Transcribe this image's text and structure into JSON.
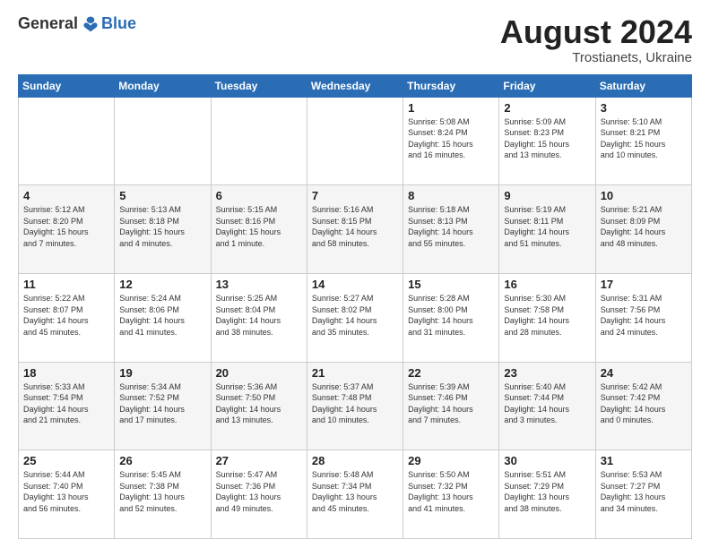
{
  "header": {
    "logo_general": "General",
    "logo_blue": "Blue",
    "month_title": "August 2024",
    "location": "Trostianets, Ukraine"
  },
  "days_of_week": [
    "Sunday",
    "Monday",
    "Tuesday",
    "Wednesday",
    "Thursday",
    "Friday",
    "Saturday"
  ],
  "weeks": [
    [
      {
        "day": "",
        "info": ""
      },
      {
        "day": "",
        "info": ""
      },
      {
        "day": "",
        "info": ""
      },
      {
        "day": "",
        "info": ""
      },
      {
        "day": "1",
        "info": "Sunrise: 5:08 AM\nSunset: 8:24 PM\nDaylight: 15 hours\nand 16 minutes."
      },
      {
        "day": "2",
        "info": "Sunrise: 5:09 AM\nSunset: 8:23 PM\nDaylight: 15 hours\nand 13 minutes."
      },
      {
        "day": "3",
        "info": "Sunrise: 5:10 AM\nSunset: 8:21 PM\nDaylight: 15 hours\nand 10 minutes."
      }
    ],
    [
      {
        "day": "4",
        "info": "Sunrise: 5:12 AM\nSunset: 8:20 PM\nDaylight: 15 hours\nand 7 minutes."
      },
      {
        "day": "5",
        "info": "Sunrise: 5:13 AM\nSunset: 8:18 PM\nDaylight: 15 hours\nand 4 minutes."
      },
      {
        "day": "6",
        "info": "Sunrise: 5:15 AM\nSunset: 8:16 PM\nDaylight: 15 hours\nand 1 minute."
      },
      {
        "day": "7",
        "info": "Sunrise: 5:16 AM\nSunset: 8:15 PM\nDaylight: 14 hours\nand 58 minutes."
      },
      {
        "day": "8",
        "info": "Sunrise: 5:18 AM\nSunset: 8:13 PM\nDaylight: 14 hours\nand 55 minutes."
      },
      {
        "day": "9",
        "info": "Sunrise: 5:19 AM\nSunset: 8:11 PM\nDaylight: 14 hours\nand 51 minutes."
      },
      {
        "day": "10",
        "info": "Sunrise: 5:21 AM\nSunset: 8:09 PM\nDaylight: 14 hours\nand 48 minutes."
      }
    ],
    [
      {
        "day": "11",
        "info": "Sunrise: 5:22 AM\nSunset: 8:07 PM\nDaylight: 14 hours\nand 45 minutes."
      },
      {
        "day": "12",
        "info": "Sunrise: 5:24 AM\nSunset: 8:06 PM\nDaylight: 14 hours\nand 41 minutes."
      },
      {
        "day": "13",
        "info": "Sunrise: 5:25 AM\nSunset: 8:04 PM\nDaylight: 14 hours\nand 38 minutes."
      },
      {
        "day": "14",
        "info": "Sunrise: 5:27 AM\nSunset: 8:02 PM\nDaylight: 14 hours\nand 35 minutes."
      },
      {
        "day": "15",
        "info": "Sunrise: 5:28 AM\nSunset: 8:00 PM\nDaylight: 14 hours\nand 31 minutes."
      },
      {
        "day": "16",
        "info": "Sunrise: 5:30 AM\nSunset: 7:58 PM\nDaylight: 14 hours\nand 28 minutes."
      },
      {
        "day": "17",
        "info": "Sunrise: 5:31 AM\nSunset: 7:56 PM\nDaylight: 14 hours\nand 24 minutes."
      }
    ],
    [
      {
        "day": "18",
        "info": "Sunrise: 5:33 AM\nSunset: 7:54 PM\nDaylight: 14 hours\nand 21 minutes."
      },
      {
        "day": "19",
        "info": "Sunrise: 5:34 AM\nSunset: 7:52 PM\nDaylight: 14 hours\nand 17 minutes."
      },
      {
        "day": "20",
        "info": "Sunrise: 5:36 AM\nSunset: 7:50 PM\nDaylight: 14 hours\nand 13 minutes."
      },
      {
        "day": "21",
        "info": "Sunrise: 5:37 AM\nSunset: 7:48 PM\nDaylight: 14 hours\nand 10 minutes."
      },
      {
        "day": "22",
        "info": "Sunrise: 5:39 AM\nSunset: 7:46 PM\nDaylight: 14 hours\nand 7 minutes."
      },
      {
        "day": "23",
        "info": "Sunrise: 5:40 AM\nSunset: 7:44 PM\nDaylight: 14 hours\nand 3 minutes."
      },
      {
        "day": "24",
        "info": "Sunrise: 5:42 AM\nSunset: 7:42 PM\nDaylight: 14 hours\nand 0 minutes."
      }
    ],
    [
      {
        "day": "25",
        "info": "Sunrise: 5:44 AM\nSunset: 7:40 PM\nDaylight: 13 hours\nand 56 minutes."
      },
      {
        "day": "26",
        "info": "Sunrise: 5:45 AM\nSunset: 7:38 PM\nDaylight: 13 hours\nand 52 minutes."
      },
      {
        "day": "27",
        "info": "Sunrise: 5:47 AM\nSunset: 7:36 PM\nDaylight: 13 hours\nand 49 minutes."
      },
      {
        "day": "28",
        "info": "Sunrise: 5:48 AM\nSunset: 7:34 PM\nDaylight: 13 hours\nand 45 minutes."
      },
      {
        "day": "29",
        "info": "Sunrise: 5:50 AM\nSunset: 7:32 PM\nDaylight: 13 hours\nand 41 minutes."
      },
      {
        "day": "30",
        "info": "Sunrise: 5:51 AM\nSunset: 7:29 PM\nDaylight: 13 hours\nand 38 minutes."
      },
      {
        "day": "31",
        "info": "Sunrise: 5:53 AM\nSunset: 7:27 PM\nDaylight: 13 hours\nand 34 minutes."
      }
    ]
  ]
}
